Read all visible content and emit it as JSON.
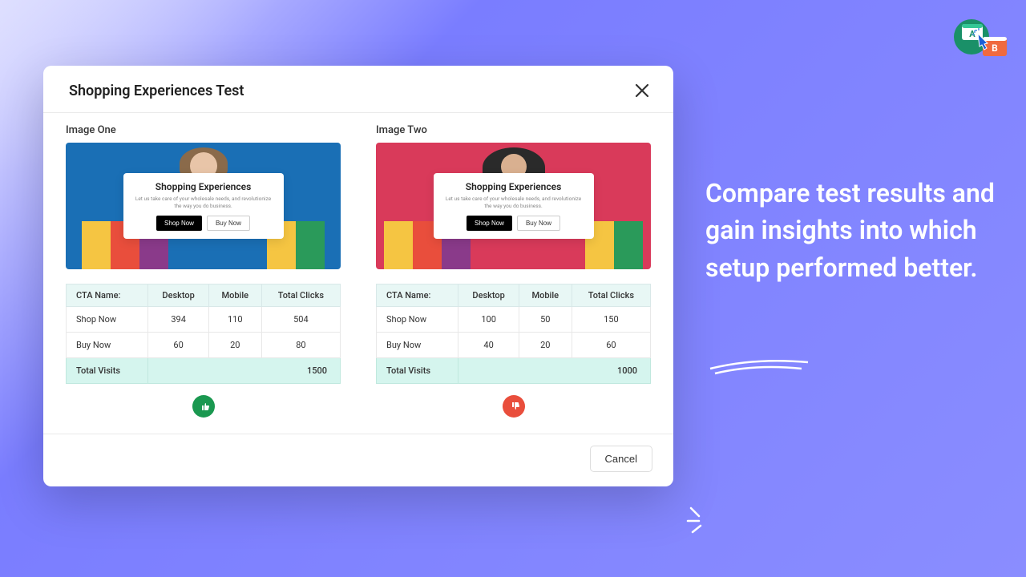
{
  "modal": {
    "title": "Shopping Experiences Test",
    "cancel": "Cancel"
  },
  "variants": [
    {
      "label": "Image One",
      "bgClass": "blue",
      "card_title": "Shopping Experiences",
      "card_sub": "Let us take care of your wholesale needs, and revolutionize the way you do business.",
      "btn1": "Shop Now",
      "btn2": "Buy Now",
      "result": "up"
    },
    {
      "label": "Image Two",
      "bgClass": "pink",
      "card_title": "Shopping Experiences",
      "card_sub": "Let us take care of your wholesale needs, and revolutionize the way you do business.",
      "btn1": "Shop Now",
      "btn2": "Buy Now",
      "result": "down"
    }
  ],
  "table": {
    "headers": {
      "cta": "CTA Name:",
      "desktop": "Desktop",
      "mobile": "Mobile",
      "total": "Total Clicks"
    },
    "rows": [
      [
        {
          "name": "Shop Now",
          "desktop": "394",
          "mobile": "110",
          "total": "504"
        },
        {
          "name": "Buy Now",
          "desktop": "60",
          "mobile": "20",
          "total": "80"
        }
      ],
      [
        {
          "name": "Shop Now",
          "desktop": "100",
          "mobile": "50",
          "total": "150"
        },
        {
          "name": "Buy Now",
          "desktop": "40",
          "mobile": "20",
          "total": "60"
        }
      ]
    ],
    "visits_label": "Total Visits",
    "visits": [
      "1500",
      "1000"
    ]
  },
  "promo": "Compare test results and gain insights into which setup performed better."
}
